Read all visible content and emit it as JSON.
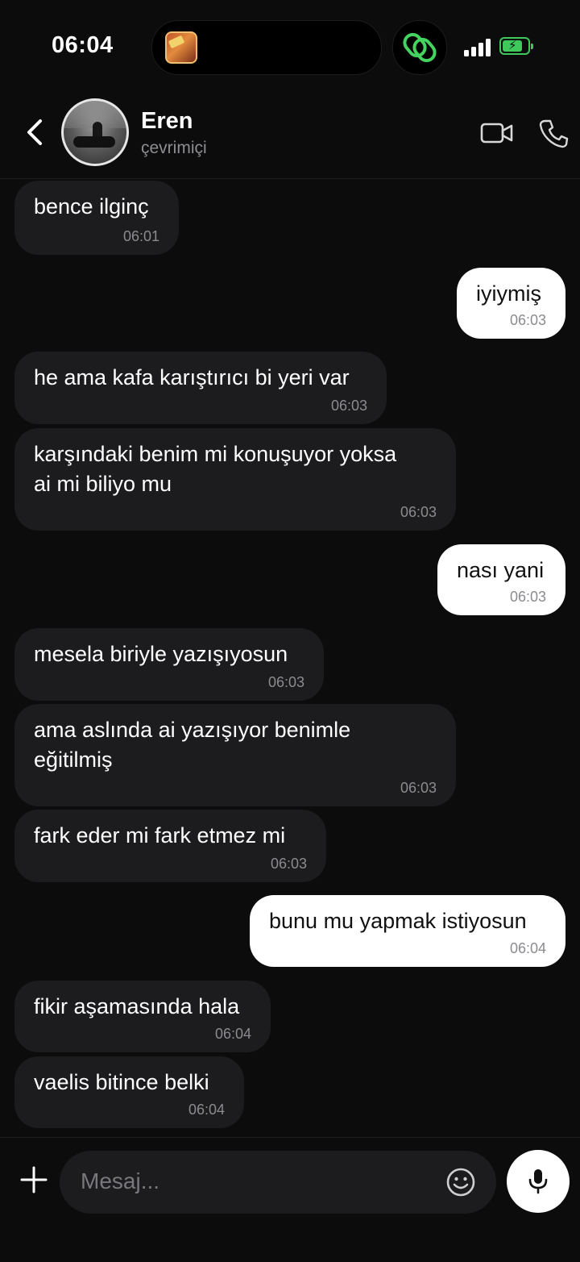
{
  "status_bar": {
    "time": "06:04"
  },
  "contact": {
    "name": "Eren",
    "status": "çevrimiçi"
  },
  "messages": [
    {
      "dir": "in",
      "text": "bence ilginç",
      "time": "06:01"
    },
    {
      "dir": "out",
      "text": "iyiymiş",
      "time": "06:03"
    },
    {
      "dir": "in",
      "text": "he ama kafa karıştırıcı bi yeri var",
      "time": "06:03"
    },
    {
      "dir": "in",
      "text": "karşındaki benim mi konuşuyor yoksa\nai mi biliyo mu",
      "time": "06:03"
    },
    {
      "dir": "out",
      "text": "nası yani",
      "time": "06:03"
    },
    {
      "dir": "in",
      "text": "mesela biriyle yazışıyosun",
      "time": "06:03"
    },
    {
      "dir": "in",
      "text": "ama aslında ai yazışıyor benimle\neğitilmiş",
      "time": "06:03"
    },
    {
      "dir": "in",
      "text": "fark eder mi fark etmez mi",
      "time": "06:03"
    },
    {
      "dir": "out",
      "text": "bunu mu yapmak istiyosun",
      "time": "06:04"
    },
    {
      "dir": "in",
      "text": "fikir aşamasında hala",
      "time": "06:04"
    },
    {
      "dir": "in",
      "text": "vaelis bitince belki",
      "time": "06:04"
    }
  ],
  "composer": {
    "placeholder": "Mesaj..."
  },
  "icons": {
    "back": "chevron-left-icon",
    "video": "video-camera-icon",
    "call": "phone-icon",
    "plus": "plus-icon",
    "emoji": "smiley-icon",
    "mic": "microphone-icon"
  },
  "colors": {
    "background": "#0c0c0d",
    "incoming_bubble": "#1c1c1e",
    "outgoing_bubble": "#ffffff",
    "battery": "#3fc95a"
  },
  "battery_level": 0.8
}
